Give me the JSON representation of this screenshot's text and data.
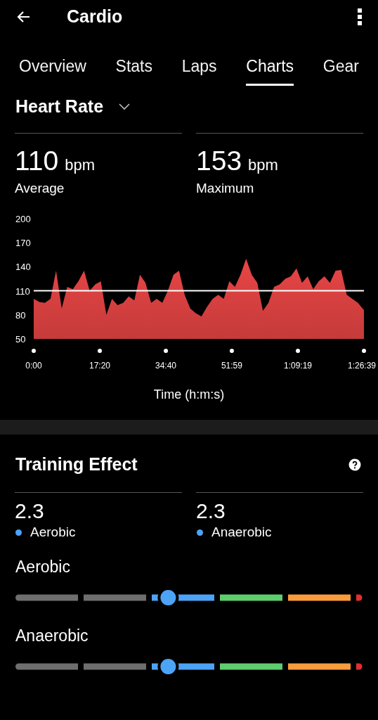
{
  "app_bar": {
    "title": "Cardio"
  },
  "tabs": [
    {
      "label": "Overview",
      "selected": false
    },
    {
      "label": "Stats",
      "selected": false
    },
    {
      "label": "Laps",
      "selected": false
    },
    {
      "label": "Charts",
      "selected": true
    },
    {
      "label": "Gear",
      "selected": false
    }
  ],
  "chart_selector": {
    "label": "Heart Rate"
  },
  "heart_rate_stats": [
    {
      "value": "110",
      "unit": "bpm",
      "label": "Average"
    },
    {
      "value": "153",
      "unit": "bpm",
      "label": "Maximum"
    }
  ],
  "heart_rate_chart": {
    "chart_data": {
      "type": "area",
      "xlabel": "Time (h:m:s)",
      "x": [
        0,
        88,
        176,
        264,
        352,
        440,
        528,
        616,
        704,
        792,
        880,
        968,
        1056,
        1144,
        1232,
        1320,
        1408,
        1496,
        1584,
        1672,
        1760,
        1848,
        1936,
        2024,
        2112,
        2200,
        2288,
        2376,
        2464,
        2552,
        2640,
        2728,
        2816,
        2904,
        2992,
        3080,
        3168,
        3256,
        3344,
        3432,
        3520,
        3608,
        3696,
        3784,
        3872,
        3960,
        4048,
        4136,
        4224,
        4312,
        4400,
        4488,
        4576,
        4664,
        4752,
        4840,
        4928,
        5016,
        5104,
        5199
      ],
      "series": [
        {
          "color": "#e84545",
          "values": [
            100,
            96,
            95,
            100,
            135,
            88,
            115,
            112,
            122,
            135,
            110,
            118,
            122,
            80,
            100,
            92,
            95,
            103,
            98,
            130,
            120,
            95,
            100,
            95,
            110,
            130,
            135,
            105,
            88,
            82,
            78,
            90,
            100,
            105,
            100,
            122,
            115,
            130,
            150,
            130,
            120,
            85,
            95,
            115,
            118,
            125,
            128,
            138,
            120,
            128,
            112,
            122,
            128,
            120,
            135,
            136,
            105,
            100,
            95,
            86
          ]
        }
      ],
      "xlim": [
        0,
        5199
      ],
      "ylim": [
        50,
        200
      ],
      "xticks": [
        {
          "value": 0,
          "label": "0:00"
        },
        {
          "value": 1040,
          "label": "17:20"
        },
        {
          "value": 2080,
          "label": "34:40"
        },
        {
          "value": 3119,
          "label": "51:59"
        },
        {
          "value": 4159,
          "label": "1:09:19"
        },
        {
          "value": 5199,
          "label": "1:26:39"
        }
      ],
      "yticks": [
        50,
        80,
        110,
        140,
        170,
        200
      ]
    }
  },
  "training_effect": {
    "title": "Training Effect",
    "values": [
      {
        "value": "2.3",
        "label": "Aerobic"
      },
      {
        "value": "2.3",
        "label": "Anaerobic"
      }
    ],
    "scales": [
      {
        "label": "Aerobic",
        "level": 0.44
      },
      {
        "label": "Anaerobic",
        "level": 0.44
      }
    ]
  }
}
